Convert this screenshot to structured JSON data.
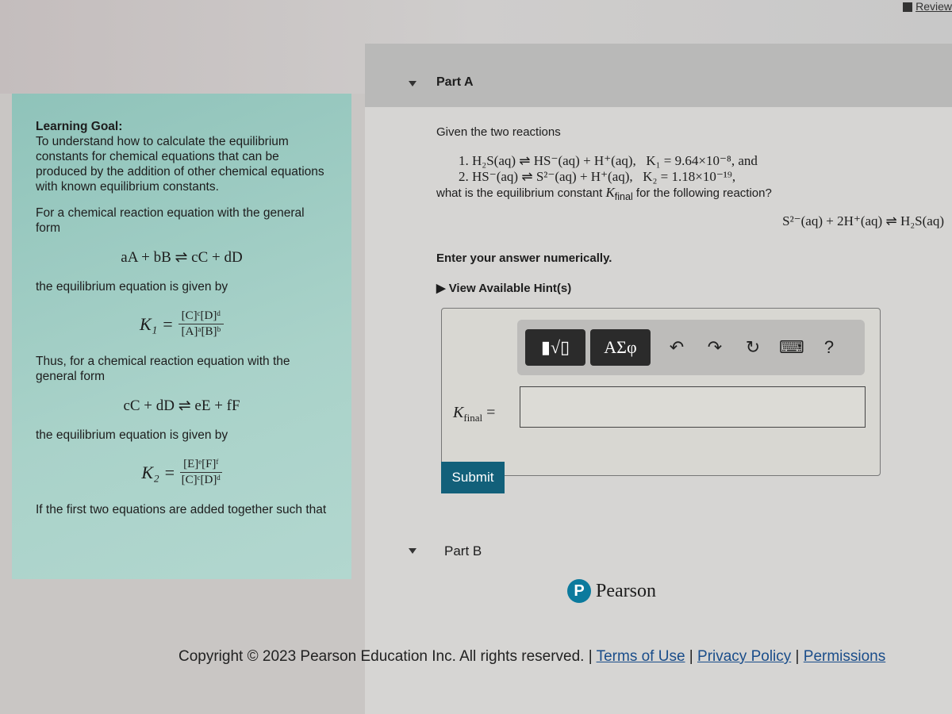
{
  "header": {
    "review_label": "Review"
  },
  "learning_goal": {
    "title": "Learning Goal:",
    "text": "To understand how to calculate the equilibrium constants for chemical equations that can be produced by the addition of other chemical equations with known equilibrium constants.",
    "p1": "For a chemical reaction equation with the general form",
    "eq1": "aA + bB ⇌ cC + dD",
    "p2": "the equilibrium equation is given by",
    "k1_label": "K₁ =",
    "k1_num": "[C]ᶜ[D]ᵈ",
    "k1_den": "[A]ᵃ[B]ᵇ",
    "p3": "Thus, for a chemical reaction equation with the general form",
    "eq2": "cC + dD ⇌ eE + fF",
    "p4": "the equilibrium equation is given by",
    "k2_label": "K₂ =",
    "k2_num": "[E]ᵉ[F]ᶠ",
    "k2_den": "[C]ᶜ[D]ᵈ",
    "p5": "If the first two equations are added together such that"
  },
  "part_a": {
    "title": "Part A",
    "intro": "Given the two reactions",
    "r1": "1. H₂S(aq) ⇌ HS⁻(aq) + H⁺(aq),",
    "k1": "K₁ = 9.64×10⁻⁸, and",
    "r2": "2. HS⁻(aq) ⇌ S²⁻(aq) + H⁺(aq),",
    "k2": "K₂ = 1.18×10⁻¹⁹,",
    "q_pre": "what is the equilibrium constant ",
    "q_k": "K",
    "q_sub": "final",
    "q_post": " for the following reaction?",
    "target": "S²⁻(aq) + 2H⁺(aq) ⇌ H₂S(aq)",
    "instruction": "Enter your answer numerically.",
    "hints": "View Available Hint(s)",
    "toolbar": {
      "templates": "▮√▯",
      "greek": "ΑΣφ",
      "help": "?"
    },
    "answer_label_k": "K",
    "answer_label_sub": "final",
    "answer_eq": " =",
    "answer_value": "",
    "submit": "Submit"
  },
  "part_b": {
    "title": "Part B"
  },
  "footer": {
    "brand": "Pearson",
    "copyright": "Copyright © 2023 Pearson Education Inc. All rights reserved. | ",
    "links": [
      "Terms of Use",
      "Privacy Policy",
      "Permissions"
    ]
  },
  "colors": {
    "learning_goal_bg": "#a9d2c9",
    "submit": "#12607a",
    "pearson": "#0b7a9d"
  }
}
